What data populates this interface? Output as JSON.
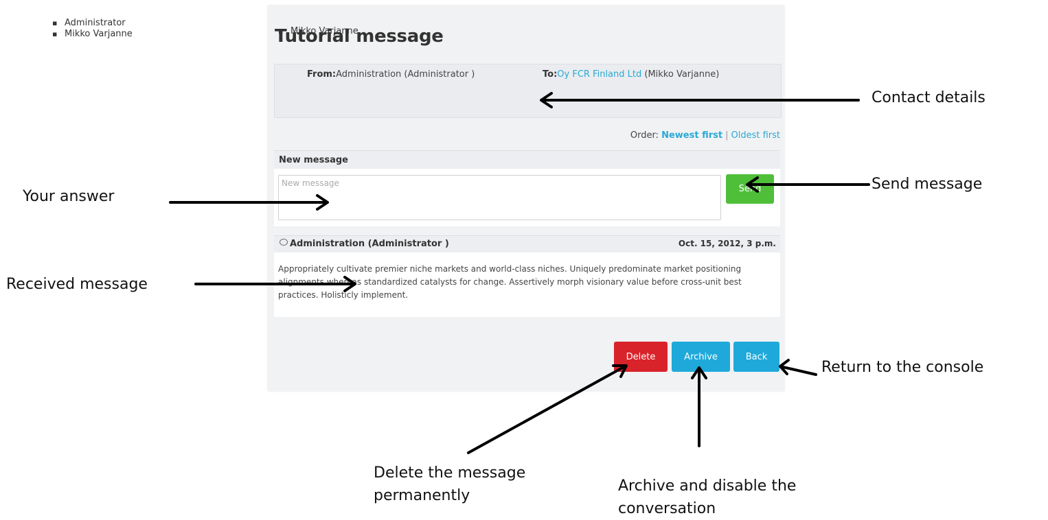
{
  "page": {
    "title": "Tutorial message"
  },
  "contact": {
    "from_label": "From:",
    "from_name": "Administration (Administrator )",
    "from_items": [
      "Administrator",
      "Mikko Varjanne"
    ],
    "to_label": "To:",
    "to_company": "Oy FCR Finland Ltd",
    "to_person": " (Mikko Varjanne)",
    "to_items": [
      "Mikko Varjanne"
    ]
  },
  "order": {
    "label": "Order:",
    "newest": "Newest first",
    "separator": "|",
    "oldest": "Oldest first"
  },
  "new_message": {
    "heading": "New message",
    "placeholder": "New message",
    "send_label": "Send"
  },
  "received": {
    "sender": "Administration (Administrator )",
    "date": "Oct. 15, 2012, 3 p.m.",
    "body": "Appropriately cultivate premier niche markets and world-class niches. Uniquely predominate market positioning alignments whereas standardized catalysts for change. Assertively morph visionary value before cross-unit best practices. Holisticly implement."
  },
  "actions": {
    "delete": "Delete",
    "archive": "Archive",
    "back": "Back"
  },
  "annotations": {
    "contact_details": "Contact details",
    "send_message": "Send message",
    "your_answer": "Your answer",
    "received_message": "Received message",
    "return_console": "Return to the console",
    "delete_line1": "Delete the message",
    "delete_line2": "permanently",
    "archive_line1": "Archive and disable the",
    "archive_line2": "conversation"
  },
  "colors": {
    "accent": "#29a9d6",
    "send": "#4fbf3a",
    "delete": "#d9232a",
    "archive_back": "#1fa9da"
  }
}
